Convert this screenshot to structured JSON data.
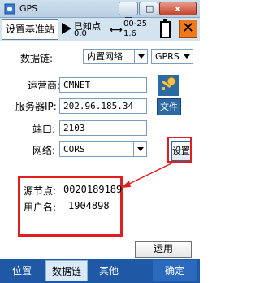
{
  "window": {
    "title": "GPS"
  },
  "status": {
    "station_button": "设置基准站",
    "solution_label": "已知点",
    "solution_value": "0.0",
    "link_glyph": "⟷",
    "age_top": "00-25",
    "age_bottom": "1.6",
    "close_glyph": "✕"
  },
  "form": {
    "datalink_label": "数据链:",
    "datalink_value": "内置网络",
    "datalink_mode_value": "GPRS",
    "operator_label": "运营商:",
    "operator_value": "CMNET",
    "server_ip_label": "服务器IP:",
    "server_ip_value": "202.96.185.34",
    "port_label": "端口:",
    "port_value": "2103",
    "network_label": "网络:",
    "network_value": "CORS",
    "file_button": "文件",
    "settings_button": "设置",
    "apply_button": "运用"
  },
  "info": {
    "source_node_label": "源节点:",
    "source_node_value": "0020189189",
    "username_label": "用户名:",
    "username_value": "1904898"
  },
  "tabs": [
    {
      "label": "位置"
    },
    {
      "label": "数据链"
    },
    {
      "label": "其他"
    },
    {
      "label": "确定"
    }
  ]
}
